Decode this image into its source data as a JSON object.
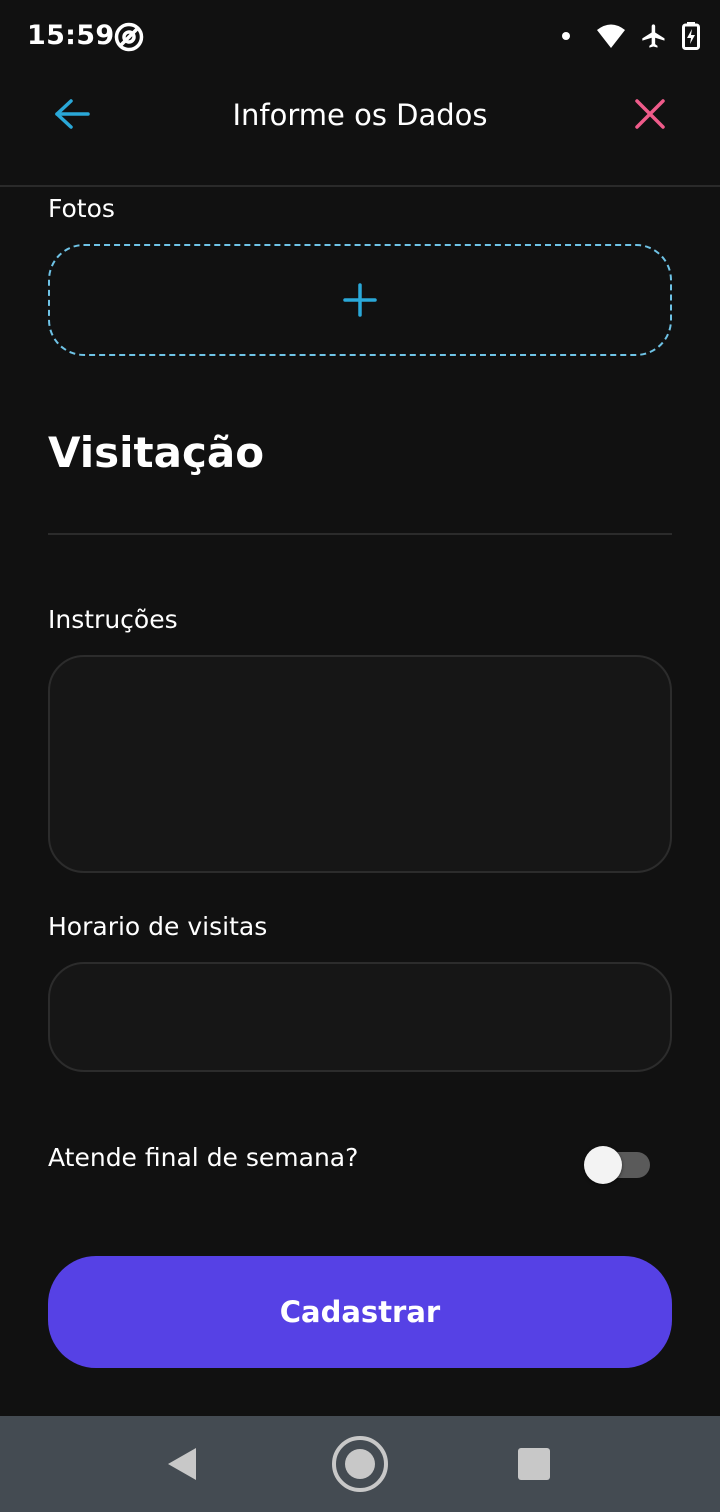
{
  "status_bar": {
    "time": "15:59"
  },
  "app_bar": {
    "title": "Informe os Dados",
    "back_icon": "arrow-left-icon",
    "close_icon": "close-icon"
  },
  "photos": {
    "label": "Fotos",
    "add_icon": "plus-icon"
  },
  "section": {
    "title": "Visitação"
  },
  "instructions": {
    "label": "Instruções",
    "value": ""
  },
  "visit_hours": {
    "label": "Horario de visitas",
    "value": ""
  },
  "weekend": {
    "label": "Atende final de semana?",
    "enabled": false
  },
  "submit": {
    "label": "Cadastrar"
  },
  "colors": {
    "background": "#111111",
    "accent_blue": "#2aa8d8",
    "close_pink": "#ef5b8a",
    "button_purple": "#5641e5",
    "nav_bar": "#444b52"
  }
}
